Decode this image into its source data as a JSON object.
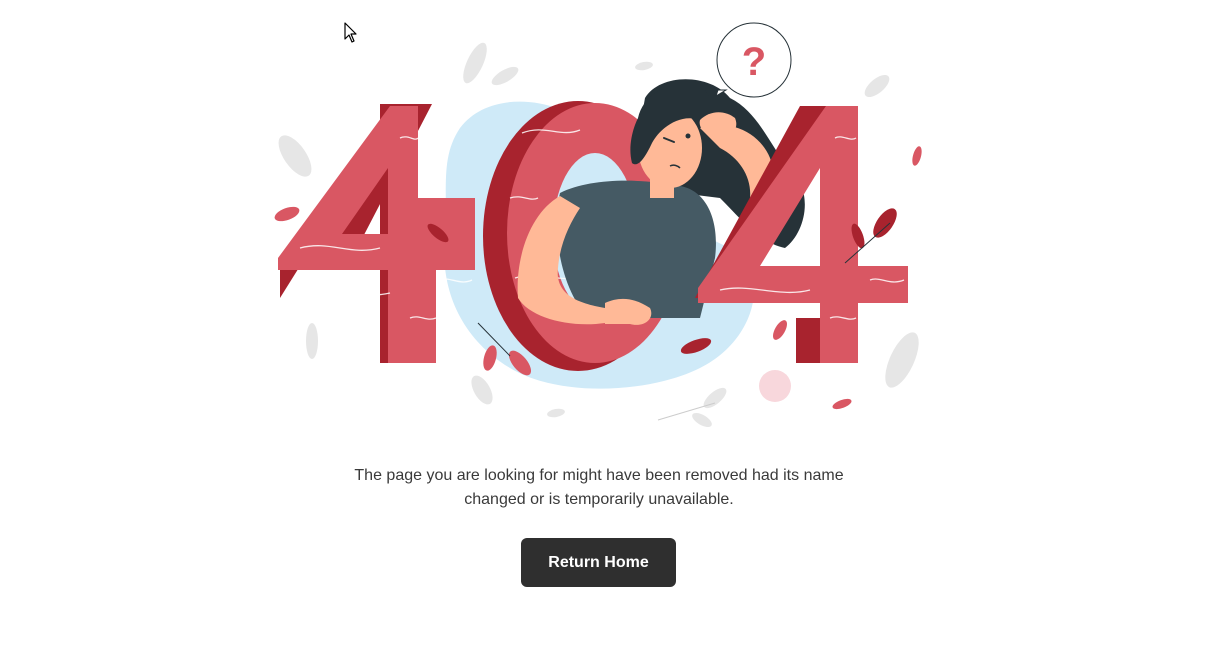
{
  "colors": {
    "digit_face": "#d95763",
    "digit_side": "#a8232e",
    "bg_blob": "#cfeaf8",
    "hair": "#263238",
    "shirt": "#455a64",
    "skin": "#ffb997",
    "leaf_grey": "#e6e6e6",
    "button_bg": "#2f2f2f",
    "button_text": "#ffffff",
    "text": "#3a3a3a"
  },
  "illustration": {
    "digits": [
      "4",
      "0",
      "4"
    ],
    "question_mark": "?"
  },
  "error": {
    "message": "The page you are looking for might have been removed had its name changed or is temporarily unavailable."
  },
  "actions": {
    "return_home_label": "Return Home"
  }
}
